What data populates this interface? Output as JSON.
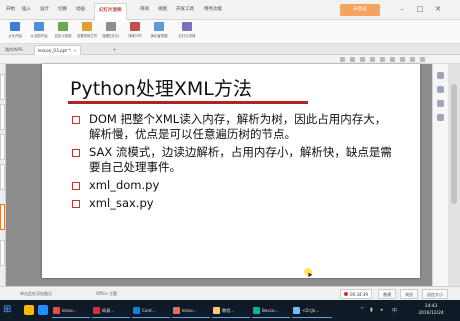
{
  "ribbon": {
    "tabs": [
      "开始",
      "插入",
      "设计",
      "切换",
      "动画",
      "幻灯片放映",
      "审阅",
      "视图",
      "开发工具",
      "特色功能"
    ],
    "active_tab": "幻灯片放映",
    "signin_label": "未登录",
    "tools": [
      {
        "label": "从头开始"
      },
      {
        "label": "从当前开始"
      },
      {
        "label": "自定义放映"
      },
      {
        "label": "设置放映方式"
      },
      {
        "label": "隐藏幻灯片"
      },
      {
        "label": "排练计时"
      },
      {
        "label": "演示者视图"
      },
      {
        "label": "幻灯片切换"
      }
    ]
  },
  "doc_tabs": [
    {
      "label": "我的WPS"
    },
    {
      "label": "lesson_03.ppt *"
    }
  ],
  "slide": {
    "title": "Python处理XML方法",
    "bullets": [
      "DOM 把整个XML读入内存，解析为树，因此占用内存大，解析慢，优点是可以任意遍历树的节点。",
      "SAX 流模式，边读边解析，占用内存小，解析快，缺点是需要自己处理事件。",
      "xml_dom.py",
      "xml_sax.py"
    ]
  },
  "statusbar": {
    "notes_hint": "单击此处添加备注",
    "theme": "Office 主题",
    "timer": "00:34:39",
    "btn_normal": "普通",
    "btn_sorter": "浏览",
    "btn_fit": "适应大小"
  },
  "taskbar": {
    "tasks": [
      "lesso...",
      "网易...",
      "Cont...",
      "lesso...",
      "教程...",
      "Becco...",
      "<D:\\Je..."
    ],
    "time": "14:43",
    "date": "2016/12/24"
  },
  "colors": {
    "accent_red": "#b22222",
    "ribbon_active": "#b7472a",
    "taskbar": "#101a26"
  }
}
